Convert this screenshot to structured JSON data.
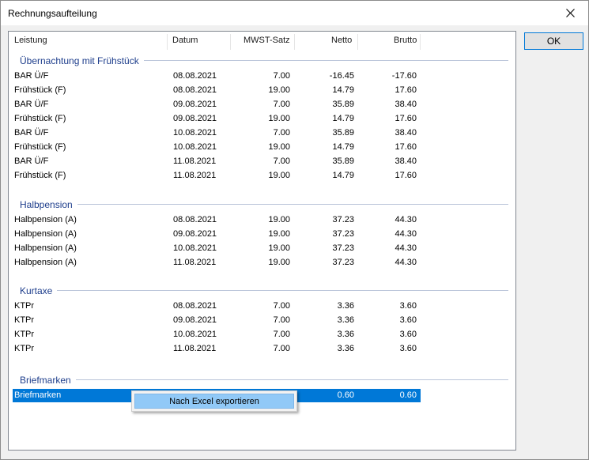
{
  "window": {
    "title": "Rechnungsaufteilung"
  },
  "ok_label": "OK",
  "columns": [
    "Leistung",
    "Datum",
    "MWST-Satz",
    "Netto",
    "Brutto"
  ],
  "groups": [
    {
      "title": "Übernachtung mit Frühstück",
      "rows": [
        [
          "BAR Ü/F",
          "08.08.2021",
          "7.00",
          "-16.45",
          "-17.60"
        ],
        [
          "Frühstück (F)",
          "08.08.2021",
          "19.00",
          "14.79",
          "17.60"
        ],
        [
          "BAR Ü/F",
          "09.08.2021",
          "7.00",
          "35.89",
          "38.40"
        ],
        [
          "Frühstück (F)",
          "09.08.2021",
          "19.00",
          "14.79",
          "17.60"
        ],
        [
          "BAR Ü/F",
          "10.08.2021",
          "7.00",
          "35.89",
          "38.40"
        ],
        [
          "Frühstück (F)",
          "10.08.2021",
          "19.00",
          "14.79",
          "17.60"
        ],
        [
          "BAR Ü/F",
          "11.08.2021",
          "7.00",
          "35.89",
          "38.40"
        ],
        [
          "Frühstück (F)",
          "11.08.2021",
          "19.00",
          "14.79",
          "17.60"
        ]
      ]
    },
    {
      "title": "Halbpension",
      "rows": [
        [
          "Halbpension (A)",
          "08.08.2021",
          "19.00",
          "37.23",
          "44.30"
        ],
        [
          "Halbpension (A)",
          "09.08.2021",
          "19.00",
          "37.23",
          "44.30"
        ],
        [
          "Halbpension (A)",
          "10.08.2021",
          "19.00",
          "37.23",
          "44.30"
        ],
        [
          "Halbpension (A)",
          "11.08.2021",
          "19.00",
          "37.23",
          "44.30"
        ]
      ]
    },
    {
      "title": "Kurtaxe",
      "rows": [
        [
          "KTPr",
          "08.08.2021",
          "7.00",
          "3.36",
          "3.60"
        ],
        [
          "KTPr",
          "09.08.2021",
          "7.00",
          "3.36",
          "3.60"
        ],
        [
          "KTPr",
          "10.08.2021",
          "7.00",
          "3.36",
          "3.60"
        ],
        [
          "KTPr",
          "11.08.2021",
          "7.00",
          "3.36",
          "3.60"
        ]
      ]
    },
    {
      "title": "Briefmarken",
      "rows": [
        [
          "Briefmarken",
          "",
          "",
          "0.60",
          "0.60"
        ]
      ]
    }
  ],
  "context_menu": {
    "items": [
      "Nach Excel exportieren"
    ]
  },
  "colors": {
    "selection": "#0078d7",
    "group_header": "#1e3e8c",
    "menu_highlight": "#91c9f7"
  }
}
